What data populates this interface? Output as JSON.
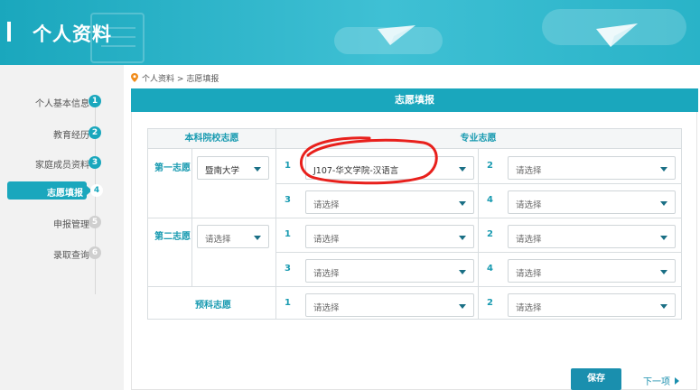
{
  "header": {
    "title": "个人资料"
  },
  "sidebar": {
    "items": [
      {
        "label": "个人基本信息",
        "num": "1",
        "state": "done"
      },
      {
        "label": "教育经历",
        "num": "2",
        "state": "done"
      },
      {
        "label": "家庭成员资料",
        "num": "3",
        "state": "done"
      },
      {
        "label": "志愿填报",
        "num": "4",
        "state": "active"
      },
      {
        "label": "申报管理",
        "num": "5",
        "state": "inactive"
      },
      {
        "label": "录取查询",
        "num": "6",
        "state": "inactive"
      }
    ]
  },
  "breadcrumb": {
    "root": "个人资料",
    "sep": ">",
    "current": "志愿填报"
  },
  "panel": {
    "title": "志愿填报"
  },
  "table": {
    "col_school": "本科院校志愿",
    "col_major": "专业志愿",
    "rows": {
      "first_label": "第一志愿",
      "second_label": "第二志愿",
      "prep_label": "预科志愿"
    },
    "first_school": "暨南大学",
    "second_school": "请选择",
    "idx": [
      "1",
      "2",
      "3",
      "4"
    ],
    "first": [
      "J107-华文学院-汉语言",
      "请选择",
      "请选择",
      "请选择"
    ],
    "second": [
      "请选择",
      "请选择",
      "请选择",
      "请选择"
    ],
    "prep": [
      "请选择",
      "请选择"
    ]
  },
  "actions": {
    "save": "保存",
    "next": "下一项"
  },
  "colors": {
    "accent": "#1aa7bd",
    "annotation": "#e8201c"
  }
}
